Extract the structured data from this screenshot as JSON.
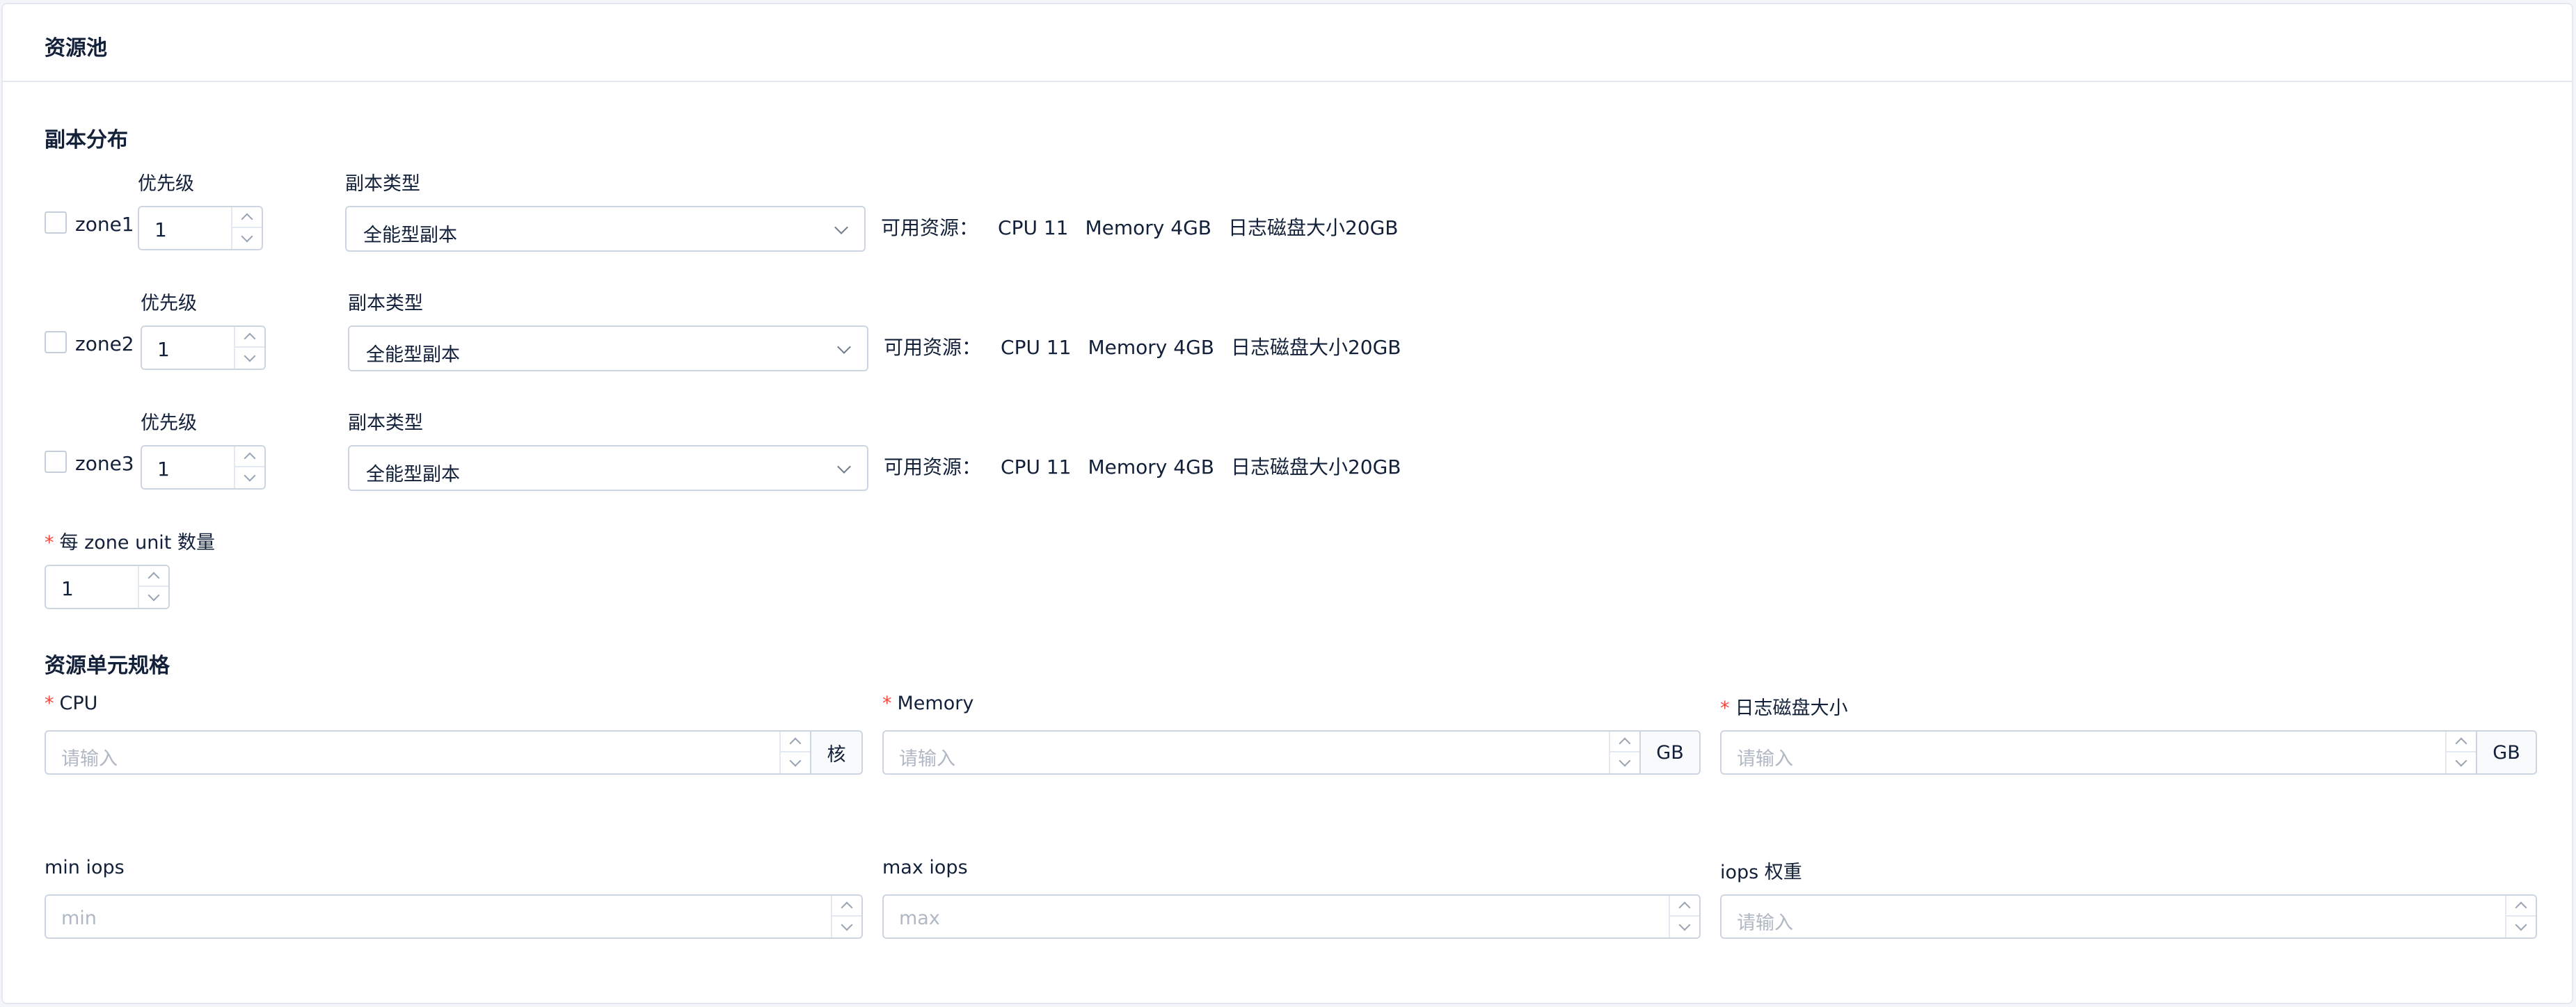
{
  "header": {
    "title": "资源池"
  },
  "replica": {
    "section_title": "副本分布",
    "priority_label": "优先级",
    "type_label": "副本类型",
    "zones": [
      {
        "name": "zone1",
        "checked": false,
        "priority": "1",
        "type": "全能型副本",
        "available_label": "可用资源：",
        "cpu": "CPU 11",
        "memory": "Memory 4GB",
        "disk": "日志磁盘大小20GB"
      },
      {
        "name": "zone2",
        "checked": false,
        "priority": "1",
        "type": "全能型副本",
        "available_label": "可用资源：",
        "cpu": "CPU 11",
        "memory": "Memory 4GB",
        "disk": "日志磁盘大小20GB"
      },
      {
        "name": "zone3",
        "checked": false,
        "priority": "1",
        "type": "全能型副本",
        "available_label": "可用资源：",
        "cpu": "CPU 11",
        "memory": "Memory 4GB",
        "disk": "日志磁盘大小20GB"
      }
    ],
    "unit_count_label": "每 zone unit 数量",
    "unit_count_value": "1"
  },
  "spec": {
    "section_title": "资源单元规格",
    "cpu": {
      "label": "CPU",
      "placeholder": "请输入",
      "unit": "核"
    },
    "memory": {
      "label": "Memory",
      "placeholder": "请输入",
      "unit": "GB"
    },
    "disk": {
      "label": "日志磁盘大小",
      "placeholder": "请输入",
      "unit": "GB"
    },
    "min_iops": {
      "label": "min iops",
      "placeholder": "min"
    },
    "max_iops": {
      "label": "max iops",
      "placeholder": "max"
    },
    "iops_weight": {
      "label": "iops 权重",
      "placeholder": "请输入"
    }
  },
  "colors": {
    "required": "#f5483b",
    "border": "#cdd5e0",
    "text": "#132039",
    "placeholder": "#b0b8c4"
  }
}
